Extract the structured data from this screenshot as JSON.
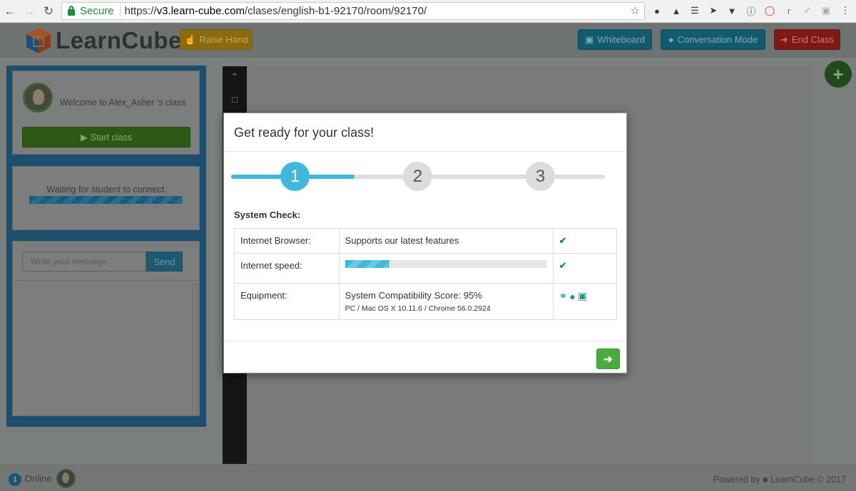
{
  "browser": {
    "secure_label": "Secure",
    "url_scheme": "https://",
    "url_host": "v3.learn-cube.com",
    "url_path": "/clases/english-b1-92170/room/92170/",
    "extension_icons": [
      "cookie-icon",
      "cat-icon",
      "stack-icon",
      "rocket-icon",
      "pocket-icon",
      "info-icon",
      "opera-icon",
      "r-icon",
      "check-ext-icon",
      "box-icon",
      "menu-dots-icon"
    ],
    "ext_r_label": "r"
  },
  "app": {
    "brand": "LearnCube",
    "raise_hand": "Raise Hand",
    "whiteboard": "Whiteboard",
    "conversation_mode": "Conversation Mode",
    "end_class": "End Class"
  },
  "sidebar": {
    "welcome": "Welcome to Alex_Asher 's class",
    "start_class": "Start class",
    "waiting": "Waiting for student to connect.",
    "message_placeholder": "Write your message",
    "send": "Send"
  },
  "modal": {
    "title": "Get ready for your class!",
    "steps": [
      "1",
      "2",
      "3"
    ],
    "active_step": 1,
    "progress_fraction": 0.33,
    "system_check_label": "System Check:",
    "rows": [
      {
        "label": "Internet Browser:",
        "value": "Supports our latest features"
      },
      {
        "label": "Internet speed:",
        "speed_fraction": 0.22
      },
      {
        "label": "Equipment:",
        "value": "System Compatibility Score: 95%",
        "detail": "PC / Mac OS X 10.11.6 / Chrome 56.0.2924"
      }
    ],
    "next_icon": "arrow-right-icon"
  },
  "footer": {
    "online_count": "1",
    "online_label": "Online",
    "powered_by": "Powered by",
    "powered_brand": "LearnCube © 2017"
  },
  "colors": {
    "accent": "#3fb8db",
    "check": "#2a7bb4",
    "next_button": "#4aab3e",
    "equipment_icons": "#1a9a8c"
  }
}
